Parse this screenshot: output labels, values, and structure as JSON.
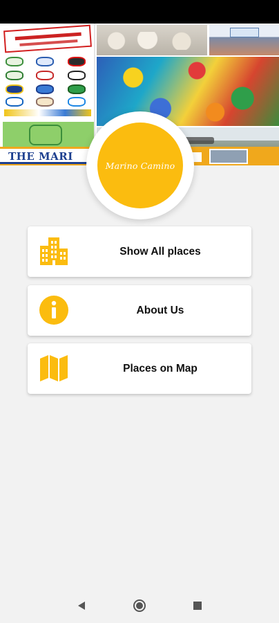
{
  "app": {
    "logo_text": "Marino Camino",
    "header_banner_text": "THE MARI",
    "accent_color": "#fbbc0f"
  },
  "menu": [
    {
      "label": "Show All places",
      "icon": "building-icon"
    },
    {
      "label": "About Us",
      "icon": "info-icon"
    },
    {
      "label": "Places on Map",
      "icon": "map-icon"
    }
  ],
  "navigation": {
    "back": "back-icon",
    "home": "home-icon",
    "recents": "recents-icon"
  }
}
